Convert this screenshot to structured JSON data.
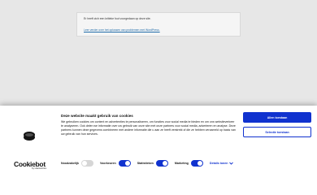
{
  "error_page": {
    "message": "Er heeft zich een kritieke fout voorgedaan op deze site.",
    "link_text": "Leer verder over het oplossen van problemen met WordPress."
  },
  "cookie_banner": {
    "title": "Deze website maakt gebruik van cookies",
    "description": "We gebruiken cookies om content en advertenties te personaliseren, om functies voor social media te bieden en om ons websiteverkeer te analyseren. Ook delen we informatie over uw gebruik van onze site met onze partners voor social media, adverteren en analyse. Deze partners kunnen deze gegevens combineren met andere informatie die u aan ze heeft verstrekt of die ze hebben verzameld op basis van uw gebruik van hun services.",
    "allow_all_label": "Allen toestaan",
    "allow_selection_label": "Selectie toestaan",
    "brand": {
      "name": "Cookiebot",
      "sub": "by Usercentrics"
    },
    "toggles": [
      {
        "label": "Noodzakelijk",
        "state": "off"
      },
      {
        "label": "Voorkeuren",
        "state": "on"
      },
      {
        "label": "Statistieken",
        "state": "on"
      },
      {
        "label": "Marketing",
        "state": "on"
      }
    ],
    "details_label": "Details tonen"
  },
  "colors": {
    "accent": "#1032cf",
    "background": "#f1f1f1",
    "link": "#2271b1"
  },
  "icons": {
    "cookie_logo": "cookie-icon",
    "details_chevron": "chevron-down-icon"
  }
}
